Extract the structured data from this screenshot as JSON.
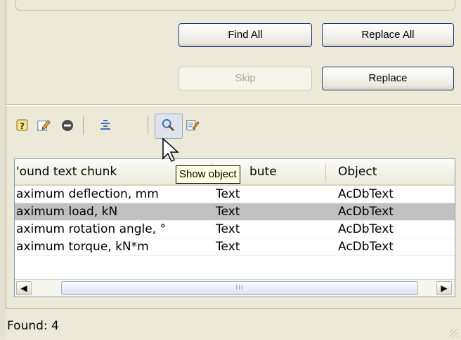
{
  "buttons": {
    "find_all": "Find All",
    "replace_all": "Replace All",
    "skip": "Skip",
    "replace": "Replace"
  },
  "toolbar": {
    "icons": [
      "help-icon",
      "edit-icon",
      "remove-icon",
      "align-icon",
      "zoom-icon",
      "edit-object-icon"
    ],
    "tooltip": "Show object"
  },
  "table": {
    "columns": [
      "'ound text chunk",
      "Attribute",
      "Object"
    ],
    "column_header_visible": [
      "'ound text chunk",
      "bute",
      "Object"
    ],
    "rows": [
      {
        "chunk": "aximum deflection, mm",
        "attribute": "Text",
        "object": "AcDbText",
        "selected": false
      },
      {
        "chunk": "aximum load, kN",
        "attribute": "Text",
        "object": "AcDbText",
        "selected": true
      },
      {
        "chunk": "aximum rotation angle, °",
        "attribute": "Text",
        "object": "AcDbText",
        "selected": false
      },
      {
        "chunk": "aximum torque, kN*m",
        "attribute": "Text",
        "object": "AcDbText",
        "selected": false
      }
    ],
    "scrollbar_thumb": "III"
  },
  "status": {
    "found": "Found: 4"
  },
  "colors": {
    "window_bg": "#ece9d8",
    "selection": "#c0c0c0",
    "button_border": "#1d3a7a",
    "tooltip_bg": "#ffffe1"
  }
}
